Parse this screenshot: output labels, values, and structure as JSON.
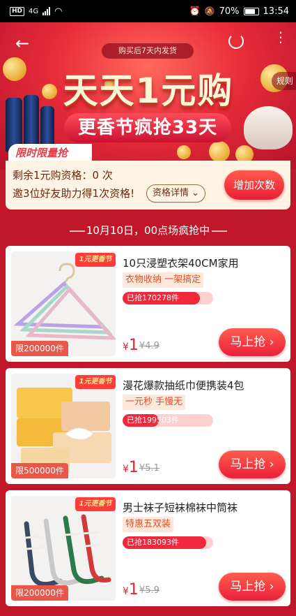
{
  "status_bar": {
    "carrier_hd": "HD",
    "network": "4G",
    "battery": "70%",
    "time": "13:54"
  },
  "banner": {
    "ship_notice": "购买后7天内发货",
    "title_main": "天天1元购",
    "title_sub": "更香节疯抢33天",
    "rules_label": "规则",
    "limited_label": "限时限量抢"
  },
  "quota": {
    "remaining_text": "剩余1元购资格：0 次",
    "invite_text": "邀3位好友助力得1次资格!",
    "detail_label": "资格详情",
    "add_button": "增加次数"
  },
  "session": {
    "label": "10月10日，00点场疯抢中"
  },
  "products": [
    {
      "festival": "1元更香节",
      "title": "10只浸塑衣架40CM家用",
      "tag": "衣物收纳 一架搞定",
      "sold": "已抢170278件",
      "sold_ratio": 0.85,
      "limit": "限200000件",
      "currency": "¥",
      "price": "1",
      "original": "¥4.9",
      "button": "马上抢"
    },
    {
      "festival": "1元更香节",
      "title": "漫花爆款抽纸巾便携装4包",
      "tag": "一元秒 手慢无",
      "sold": "已抢199503件",
      "sold_ratio": 0.4,
      "limit": "限500000件",
      "currency": "¥",
      "price": "1",
      "original": "¥5.1",
      "button": "马上抢"
    },
    {
      "festival": "1元更香节",
      "title": "男士袜子短袜棉袜中筒袜",
      "tag": "特惠五双装",
      "sold": "已抢183093件",
      "sold_ratio": 0.92,
      "limit": "限200000件",
      "currency": "¥",
      "price": "1",
      "original": "¥5.9",
      "button": "马上抢"
    }
  ]
}
